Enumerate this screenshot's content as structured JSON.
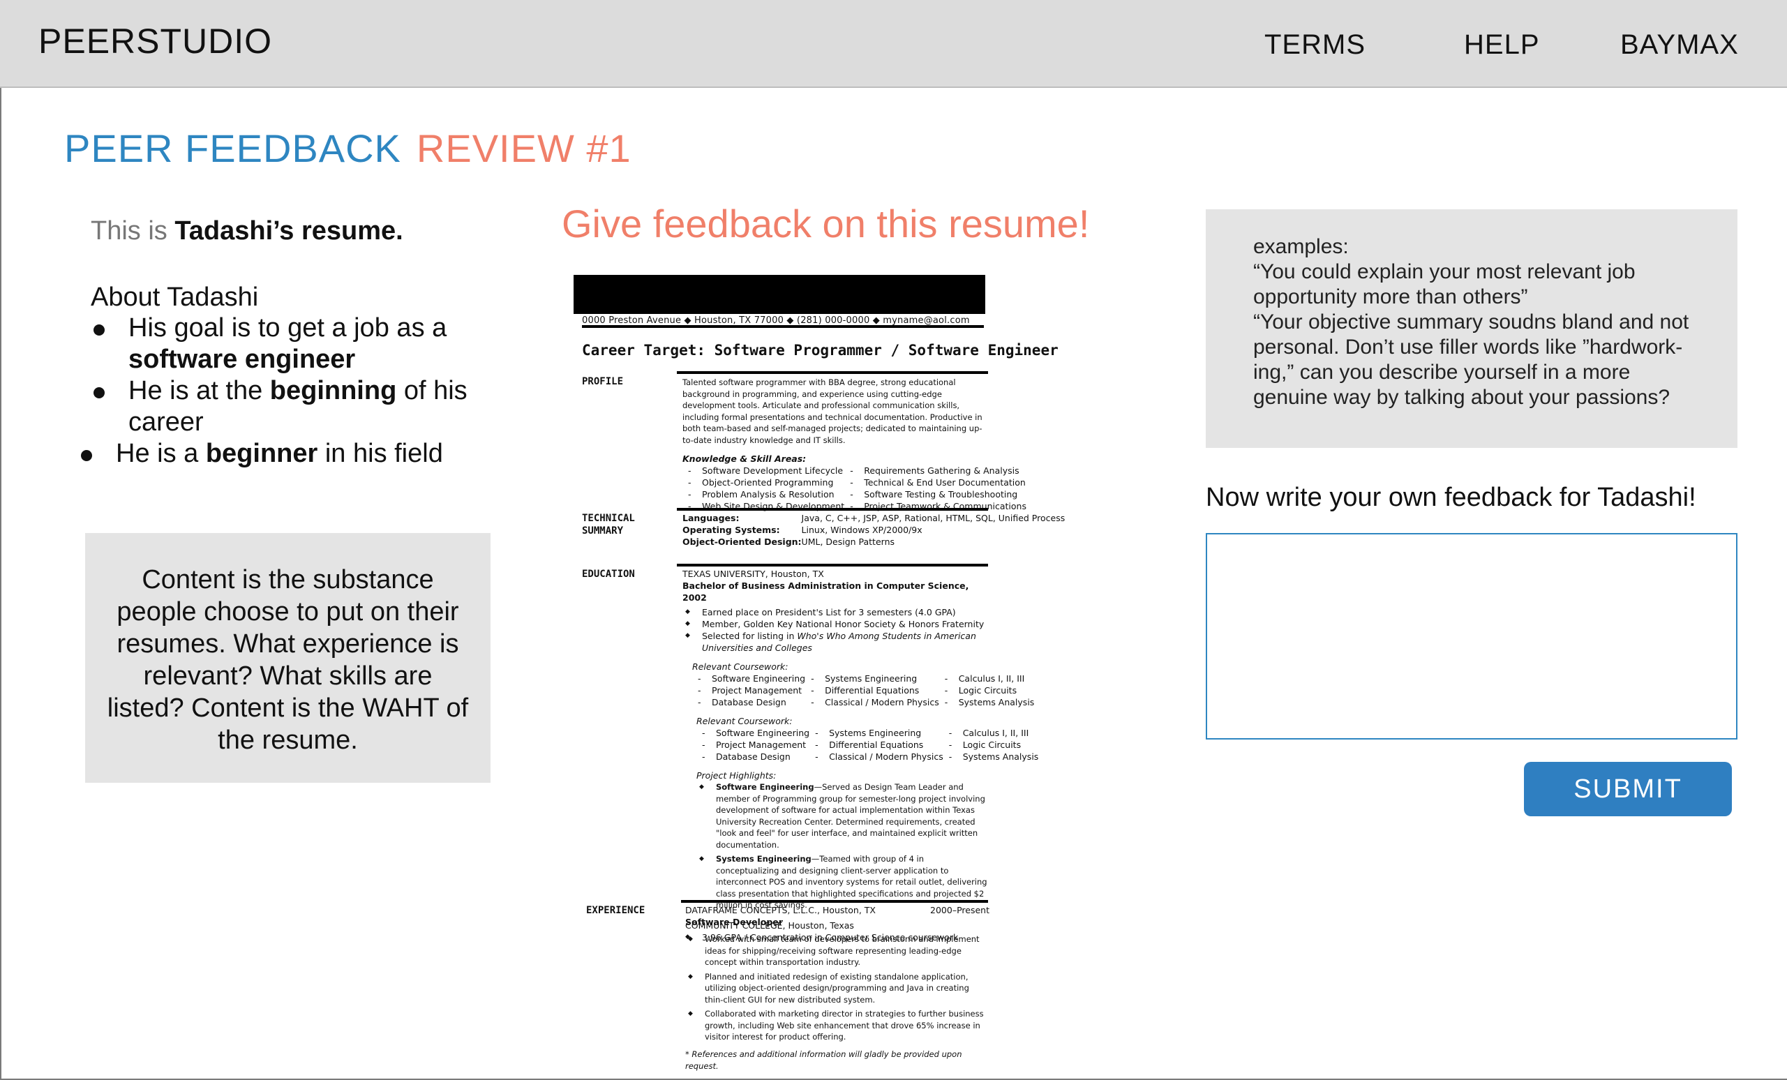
{
  "header": {
    "brand": "PEERSTUDIO",
    "nav": [
      "TERMS",
      "HELP",
      "BAYMAX"
    ]
  },
  "page": {
    "title_part1": "PEER FEEDBACK",
    "title_part2": "REVIEW #1"
  },
  "left": {
    "intro_prefix": "This is ",
    "intro_bold": "Tadashi’s resume.",
    "about_title": "About Tadashi",
    "about_items": [
      {
        "pre": "His goal is to get a job as a ",
        "bold": "software engineer",
        "post": ""
      },
      {
        "pre": "He is at the ",
        "bold": "beginning",
        "post": " of his career"
      },
      {
        "pre": "He is a ",
        "bold": "beginner",
        "post": " in his field"
      }
    ],
    "content_note": "Content is the substance people choose to put on their resumes.  What experience is relevant? What skills are listed?  Content is the WAHT of the resume."
  },
  "center": {
    "give_title": "Give feedback on this resume!"
  },
  "resume": {
    "contact": "0000 Preston Avenue  ◆  Houston, TX 77000  ◆  (281) 000-0000  ◆  myname@aol.com",
    "career_target": "Career Target: Software Programmer / Software Engineer",
    "sec_profile": "PROFILE",
    "profile_text": "Talented software programmer with BBA degree, strong educational background in programming, and experience using cutting-edge development tools. Articulate and professional communication skills, including formal presentations and technical documentation. Productive in both team-based and self-managed projects; dedicated to maintaining up-to-date industry knowledge and IT skills.",
    "skills_title": "Knowledge & Skill Areas:",
    "skills_left": [
      "Software Development Lifecycle",
      "Object-Oriented Programming",
      "Problem Analysis & Resolution",
      "Web Site Design & Development"
    ],
    "skills_right": [
      "Requirements Gathering & Analysis",
      "Technical & End User Documentation",
      "Software Testing & Troubleshooting",
      "Project Teamwork & Communications"
    ],
    "sec_technical": "TECHNICAL",
    "sec_summary": "SUMMARY",
    "tech_labels": [
      "Languages:",
      "Operating Systems:",
      "Object-Oriented Design:"
    ],
    "tech_values": [
      "Java, C, C++, JSP, ASP, Rational, HTML, SQL, Unified Process",
      "Linux, Windows XP/2000/9x",
      "UML, Design Patterns"
    ],
    "sec_education": "EDUCATION",
    "edu_school": "TEXAS UNIVERSITY, Houston, TX",
    "edu_degree": "Bachelor of Business Administration in Computer Science, 2002",
    "edu_bullets": [
      "Earned place on President's List for 3 semesters (4.0 GPA)",
      "Member, Golden Key National Honor Society & Honors Fraternity"
    ],
    "edu_bullet3_pre": "Selected for listing in ",
    "edu_bullet3_ital": "Who's Who Among Students in American Universities and Colleges",
    "coursework_title": "Relevant Coursework:",
    "course_col1": [
      "Software Engineering",
      "Project Management",
      "Database Design"
    ],
    "course_col2": [
      "Systems Engineering",
      "Differential Equations",
      "Classical / Modern Physics"
    ],
    "course_col3": [
      "Calculus I, II, III",
      "Logic Circuits",
      "Systems Analysis"
    ],
    "highlights_title": "Project Highlights:",
    "highlight1_bold": "Software Engineering",
    "highlight1_text": "—Served as Design Team Leader and member of Programming group for semester-long project involving development of software for actual implementation within Texas University Recreation Center. Determined requirements, created \"look and feel\" for user interface, and maintained explicit written documentation.",
    "highlight2_bold": "Systems Engineering",
    "highlight2_text": "—Teamed with group of 4 in conceptualizing and designing client-server application to interconnect POS and inventory systems for retail outlet, delivering class presentation that highlighted specifications and projected $2 million in cost savings.",
    "cc_name": "COMMUNITY COLLEGE, Houston, Texas",
    "cc_bullet": "3.96 GPA / Concentration in Computer Science coursework",
    "sec_experience": "EXPERIENCE",
    "exp_company": "DATAFRAME CONCEPTS, L.L.C., Houston, TX",
    "exp_dates": "2000–Present",
    "exp_title": "Software Developer",
    "exp_bullets": [
      "Worked with small team of developers to brainstorm and implement ideas for shipping/receiving software representing leading-edge concept within transportation industry.",
      "Planned and initiated redesign of existing standalone application, utilizing object-oriented design/programming and Java in creating thin-client GUI for new distributed system.",
      "Collaborated with marketing director in strategies to further business growth, including Web site enhancement that drove 65% increase in visitor interest for product offering."
    ],
    "footnote": "* References and additional information will gladly be provided upon request."
  },
  "right": {
    "examples_label": "examples:",
    "example1": "“You could explain your most relevant job opportunity more than others”",
    "example2": "“Your objective summary soudns bland and not personal.  Don’t use filler words like ”hardwork-ing,” can you describe yourself in a more genuine way by talking about your passions?",
    "prompt": "Now write your own feedback for Tadashi!",
    "input_value": "",
    "submit_label": "SUBMIT"
  },
  "colors": {
    "accent_blue": "#2e86c1",
    "accent_coral": "#f07f69",
    "header_bg": "#dcdcdc",
    "panel_bg": "#e4e4e4"
  }
}
